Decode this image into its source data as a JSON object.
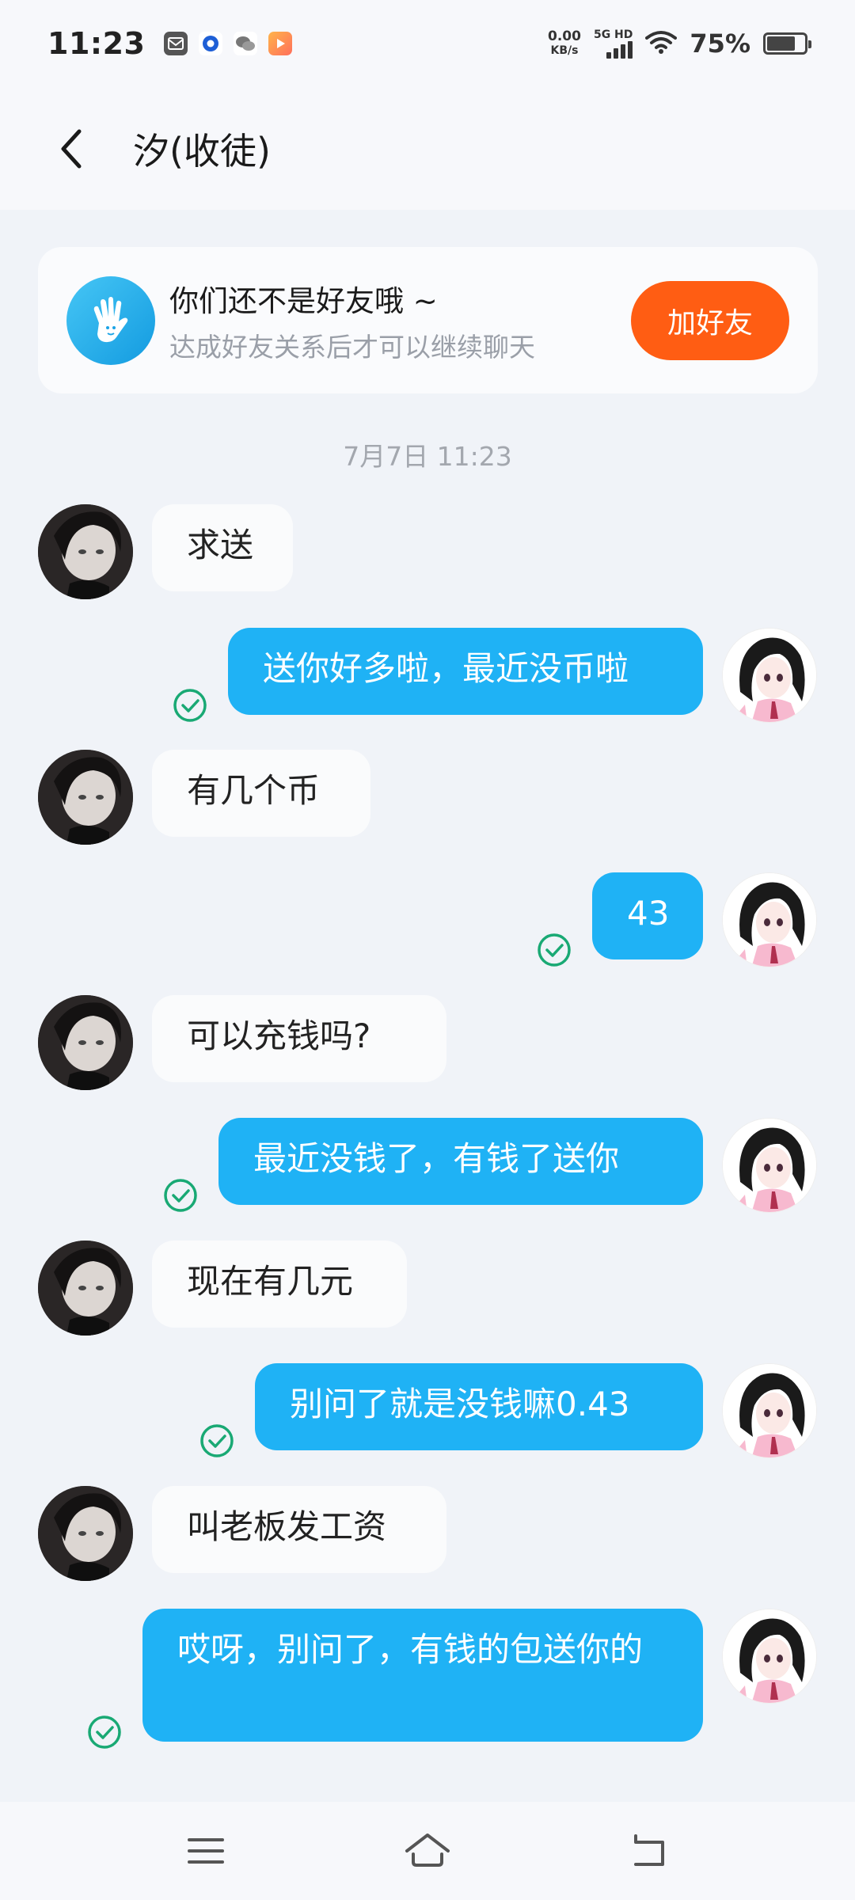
{
  "status_bar": {
    "time": "11:23",
    "net_speed_value": "0.00",
    "net_speed_unit": "KB/s",
    "net_type": "5G HD",
    "battery_percent": "75%",
    "battery_level": 0.75,
    "notification_icons": [
      "mail-icon",
      "browser-icon",
      "wechat-icon",
      "video-app-icon"
    ]
  },
  "header": {
    "title": "汐(收徒)",
    "back_icon": "chevron-left-icon"
  },
  "friend_banner": {
    "title": "你们还不是好友哦 ~",
    "subtitle": "达成好友关系后才可以继续聊天",
    "button_label": "加好友",
    "icon": "waving-hand-icon"
  },
  "timestamp": "7月7日 11:23",
  "messages": [
    {
      "from": "peer",
      "text": "求送"
    },
    {
      "from": "self",
      "text": "送你好多啦，最近没币啦",
      "read": true
    },
    {
      "from": "peer",
      "text": "有几个币"
    },
    {
      "from": "self",
      "text": "43",
      "read": true
    },
    {
      "from": "peer",
      "text": "可以充钱吗?"
    },
    {
      "from": "self",
      "text": "最近没钱了，有钱了送你",
      "read": true
    },
    {
      "from": "peer",
      "text": "现在有几元"
    },
    {
      "from": "self",
      "text": "别问了就是没钱嘛0.43",
      "read": true
    },
    {
      "from": "peer",
      "text": "叫老板发工资"
    },
    {
      "from": "self",
      "text": "哎呀，别问了，有钱的包送你的",
      "read": true
    }
  ],
  "colors": {
    "accent_blue": "#1fb2f5",
    "add_friend_orange": "#ff5d13",
    "read_check_green": "#19a974"
  },
  "system_nav": [
    "menu-icon",
    "home-icon",
    "back-icon"
  ]
}
